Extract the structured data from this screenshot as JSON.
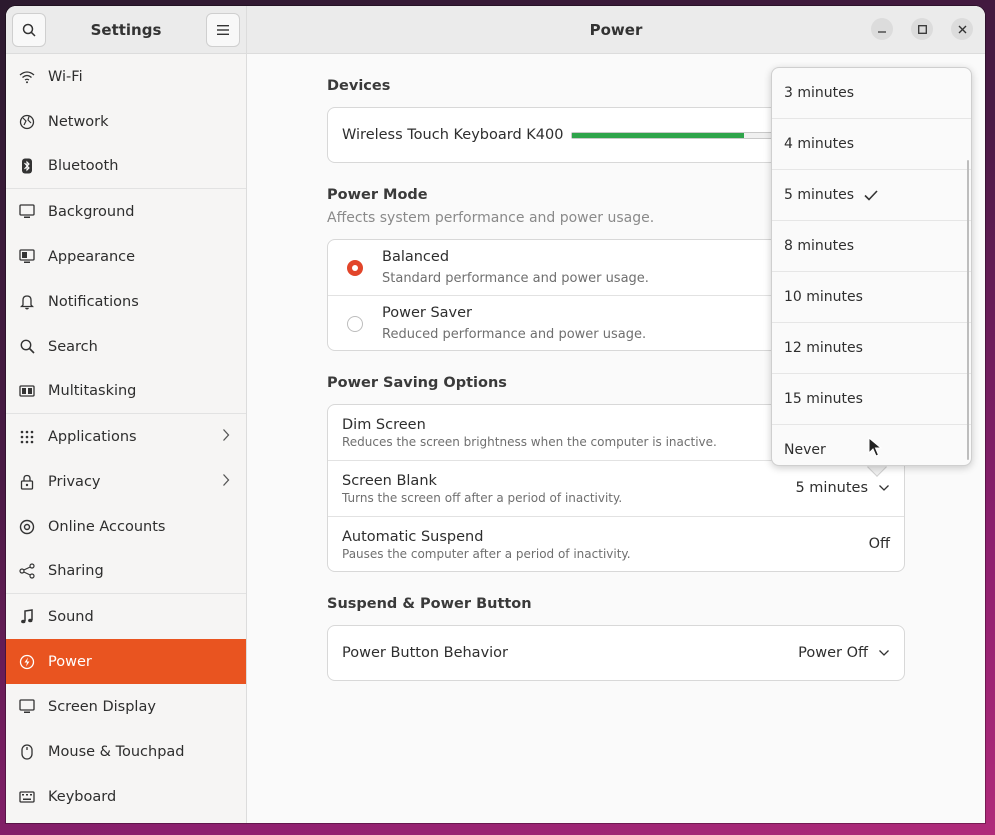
{
  "sidebar": {
    "title": "Settings",
    "items": [
      {
        "label": "Wi-Fi",
        "icon": "wifi-icon"
      },
      {
        "label": "Network",
        "icon": "globe-icon"
      },
      {
        "label": "Bluetooth",
        "icon": "bluetooth-icon"
      },
      {
        "label": "Background",
        "icon": "monitor-icon"
      },
      {
        "label": "Appearance",
        "icon": "appearance-icon"
      },
      {
        "label": "Notifications",
        "icon": "bell-icon"
      },
      {
        "label": "Search",
        "icon": "search-icon"
      },
      {
        "label": "Multitasking",
        "icon": "multitasking-icon"
      },
      {
        "label": "Applications",
        "icon": "grid-icon"
      },
      {
        "label": "Privacy",
        "icon": "lock-icon"
      },
      {
        "label": "Online Accounts",
        "icon": "accounts-icon"
      },
      {
        "label": "Sharing",
        "icon": "share-icon"
      },
      {
        "label": "Sound",
        "icon": "music-note-icon"
      },
      {
        "label": "Power",
        "icon": "power-icon"
      },
      {
        "label": "Screen Display",
        "icon": "display-icon"
      },
      {
        "label": "Mouse & Touchpad",
        "icon": "mouse-icon"
      },
      {
        "label": "Keyboard",
        "icon": "keyboard-icon"
      }
    ]
  },
  "header": {
    "title": "Power"
  },
  "devices": {
    "title": "Devices",
    "keyboard_label": "Wireless Touch Keyboard K400"
  },
  "power_mode": {
    "title": "Power Mode",
    "subtitle": "Affects system performance and power usage.",
    "options": [
      {
        "label": "Balanced",
        "desc": "Standard performance and power usage."
      },
      {
        "label": "Power Saver",
        "desc": "Reduced performance and power usage."
      }
    ]
  },
  "saving": {
    "title": "Power Saving Options",
    "dim_title": "Dim Screen",
    "dim_desc": "Reduces the screen brightness when the computer is inactive.",
    "blank_title": "Screen Blank",
    "blank_desc": "Turns the screen off after a period of inactivity.",
    "blank_value": "5 minutes",
    "suspend_title": "Automatic Suspend",
    "suspend_desc": "Pauses the computer after a period of inactivity.",
    "suspend_value": "Off"
  },
  "suspend_button": {
    "title": "Suspend & Power Button",
    "behavior_label": "Power Button Behavior",
    "behavior_value": "Power Off"
  },
  "popover": {
    "options": [
      "3 minutes",
      "4 minutes",
      "5 minutes",
      "8 minutes",
      "10 minutes",
      "12 minutes",
      "15 minutes",
      "Never"
    ],
    "selected": "5 minutes"
  },
  "colors": {
    "accent": "#e95420",
    "battery": "#2ea44a"
  }
}
